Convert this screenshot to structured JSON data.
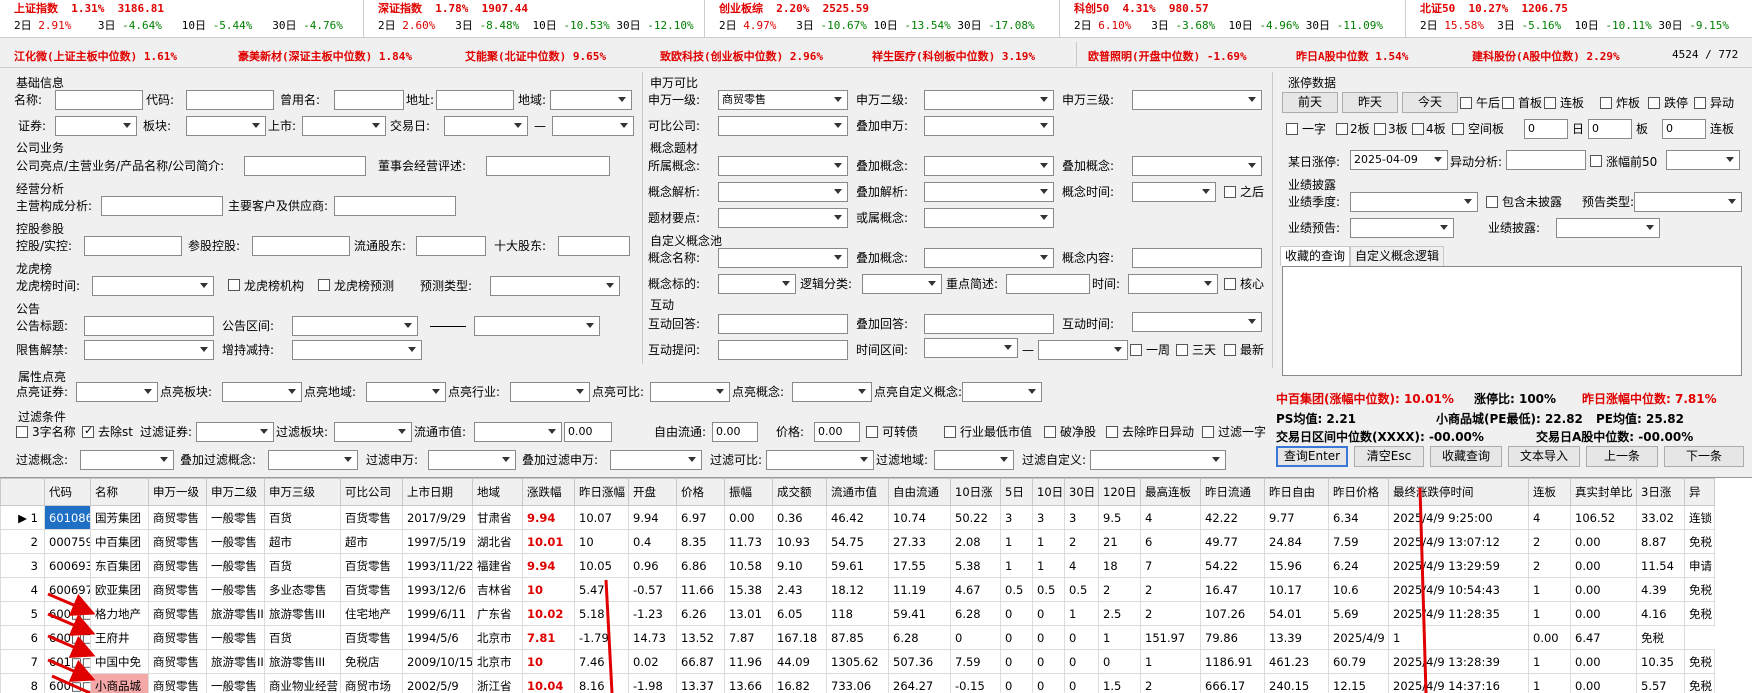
{
  "indices": [
    {
      "name": "上证指数",
      "pct": "1.31%",
      "value": "3186.81",
      "d2": "2.91%",
      "d3": "-4.64%",
      "d10": "-5.44%",
      "d30": "-4.76%"
    },
    {
      "name": "深证指数",
      "pct": "1.78%",
      "value": "1907.44",
      "d2": "2.60%",
      "d3": "-8.48%",
      "d10": "-10.53%",
      "d30": "-12.10%"
    },
    {
      "name": "创业板综",
      "pct": "2.20%",
      "value": "2525.59",
      "d2": "4.97%",
      "d3": "-10.67%",
      "d10": "-13.54%",
      "d30": "-17.08%"
    },
    {
      "name": "科创50",
      "pct": "4.31%",
      "value": "980.57",
      "d2": "6.10%",
      "d3": "-3.68%",
      "d10": "-4.96%",
      "d30": "-11.09%"
    },
    {
      "name": "北证50",
      "pct": "10.27%",
      "value": "1206.75",
      "d2": "15.58%",
      "d3": "-5.16%",
      "d10": "-10.11%",
      "d30": "-9.15%"
    }
  ],
  "index_period_labels": {
    "d2": "2日",
    "d3": "3日",
    "d10": "10日",
    "d30": "30日"
  },
  "medians": [
    "江化微(上证主板中位数) 1.61%",
    "豪美新材(深证主板中位数) 1.84%",
    "艾能聚(北证中位数) 9.65%",
    "致欧科技(创业板中位数) 2.96%",
    "祥生医疗(科创板中位数) 3.19%",
    "欧普照明(开盘中位数) -1.69%",
    "昨日A股中位数 1.54%",
    "建科股份(A股中位数) 2.29%"
  ],
  "up_down_count": "4524 / 772",
  "left": {
    "basic_title": "基础信息",
    "name_l": "名称:",
    "code_l": "代码:",
    "former_l": "曾用名:",
    "addr_l": "地址:",
    "region_l": "地域:",
    "sec_l": "证券:",
    "board_l": "板块:",
    "listing_l": "上市:",
    "trade_l": "交易日:",
    "dash": "—",
    "biz_title": "公司业务",
    "biz_l": "公司亮点/主营业务/产品名称/公司简介:",
    "board_review_l": "董事会经营评述:",
    "ops_title": "经营分析",
    "main_l": "主营构成分析:",
    "cust_l": "主要客户及供应商:",
    "hold_title": "控股参股",
    "hold_l": "控股/实控:",
    "part_l": "参股控股:",
    "float_l": "流通股东:",
    "top10_l": "十大股东:",
    "dragon_title": "龙虎榜",
    "dragon_time_l": "龙虎榜时间:",
    "dragon_org_l": "龙虎榜机构",
    "dragon_pred_l": "龙虎榜预测",
    "pred_type_l": "预测类型:",
    "notice_title": "公告",
    "notice_l": "公告标题:",
    "notice_range_l": "公告区间:",
    "unlock_l": "限售解禁:",
    "hold_change_l": "增持减持:",
    "attr_title": "属性点亮",
    "hl_sec_l": "点亮证券:",
    "hl_board_l": "点亮板块:",
    "hl_region_l": "点亮地域:",
    "hl_ind_l": "点亮行业:",
    "hl_comp_l": "点亮可比:",
    "hl_concept_l": "点亮概念:",
    "hl_custom_l": "点亮自定义概念:",
    "filter_title": "过滤条件",
    "f3_l": "3字名称",
    "fst_l": "去除st",
    "f_sec_l": "过滤证券:",
    "f_board_l": "过滤板块:",
    "f_cap_l": "流通市值:",
    "f_cap_v": "0.00",
    "f_free_l": "自由流通:",
    "f_free_v": "0.00",
    "f_price_l": "价格:",
    "f_price_v": "0.00",
    "f_conv_l": "可转债",
    "f_ind_low_l": "行业最低市值",
    "f_break_l": "破净股",
    "f_yest_l": "去除昨日异动",
    "f_oneword_l": "过滤一字",
    "f_concept_l": "过滤概念:",
    "f_addconcept_l": "叠加过滤概念:",
    "f_sw_l": "过滤申万:",
    "f_addsw_l": "叠加过滤申万:",
    "f_comp_l": "过滤可比:",
    "f_region_l": "过滤地域:",
    "f_custom_l": "过滤自定义:"
  },
  "mid": {
    "sw_title": "申万可比",
    "sw1_l": "申万一级:",
    "sw1_v": "商贸零售",
    "sw2_l": "申万二级:",
    "sw3_l": "申万三级:",
    "comp_l": "可比公司:",
    "addsw_l": "叠加申万:",
    "concept_title": "概念题材",
    "own_l": "所属概念:",
    "add1_l": "叠加概念:",
    "add2_l": "叠加概念:",
    "cparse_l": "概念解析:",
    "addparse_l": "叠加解析:",
    "ctime_l": "概念时间:",
    "after_l": "之后",
    "theme_l": "题材要点:",
    "or_l": "或属概念:",
    "custom_title": "自定义概念池",
    "cname_l": "概念名称:",
    "cadd_l": "叠加概念:",
    "ccontent_l": "概念内容:",
    "ctarget_l": "概念标的:",
    "logic_l": "逻辑分类:",
    "brief_l": "重点简述:",
    "time_l": "时间:",
    "core_l": "核心",
    "inter_title": "互动",
    "ans_l": "互动回答:",
    "addans_l": "叠加回答:",
    "itime_l": "互动时间:",
    "ask_l": "互动提问:",
    "range_l": "时间区间:",
    "week_l": "一周",
    "three_l": "三天",
    "latest_l": "最新"
  },
  "right": {
    "limit_title": "涨停数据",
    "btn_pre": "前天",
    "btn_yest": "昨天",
    "btn_today": "今天",
    "am_l": "午后",
    "first_l": "首板",
    "cont_l": "连板",
    "blast_l": "炸板",
    "drop_l": "跌停",
    "abn_l": "异动",
    "oneword_l": "一字",
    "b2_l": "2板",
    "b3_l": "3板",
    "b4_l": "4板",
    "empty_l": "空间板",
    "v0a": "0",
    "day_l": "日",
    "v0b": "0",
    "board_l": "板",
    "v0c": "0",
    "contb_l": "连板",
    "someday_l": "某日涨停:",
    "someday_v": "2025-04-09",
    "abn_anal_l": "异动分析:",
    "top50_l": "涨幅前50",
    "perf_title": "业绩披露",
    "season_l": "业绩季度:",
    "undisc_l": "包含未披露",
    "fore_type_l": "预告类型:",
    "fore_l": "业绩预告:",
    "disc_l": "业绩披露:",
    "tab1": "收藏的查询",
    "tab2": "自定义概念逻辑",
    "s1": "中百集团(涨幅中位数): 10.01%",
    "s2": "涨停比: 100%",
    "s3": "昨日涨幅中位数: 7.81%",
    "ps": "PS均值: 2.21",
    "small": "小商品城(PE最低): 22.82",
    "pe": "PE均值: 25.82",
    "range_med": "交易日区间中位数(XXXX):    -00.00%",
    "a_med": "交易日A股中位数:  -00.00%",
    "b_query": "查询Enter",
    "b_clear": "清空Esc",
    "b_fav": "收藏查询",
    "b_import": "文本导入",
    "b_prev": "上一条",
    "b_next": "下一条"
  },
  "table": {
    "headers": [
      "",
      "代码",
      "名称",
      "申万一级",
      "申万二级",
      "申万三级",
      "可比公司",
      "上市日期",
      "地域",
      "涨跌幅",
      "昨日涨幅",
      "开盘",
      "价格",
      "振幅",
      "成交额",
      "流通市值",
      "自由流通",
      "10日涨",
      "5日",
      "10日",
      "30日",
      "120日",
      "最高连板",
      "昨日流通",
      "昨日自由",
      "昨日价格",
      "最终涨跌停时间",
      "连板",
      "真实封单比",
      "3日涨",
      "异"
    ],
    "rows": [
      [
        "▶ 1",
        "601086",
        "国芳集团",
        "商贸零售",
        "一般零售",
        "百货",
        "百货零售",
        "2017/9/29",
        "甘肃省",
        "9.94",
        "10.07",
        "9.94",
        "6.97",
        "0.00",
        "0.36",
        "46.42",
        "10.74",
        "50.22",
        "3",
        "3",
        "3",
        "9.5",
        "4",
        "42.22",
        "9.77",
        "6.34",
        "2025/4/9 9:25:00",
        "4",
        "106.52",
        "33.02",
        "连锁"
      ],
      [
        "2",
        "000759",
        "中百集团",
        "商贸零售",
        "一般零售",
        "超市",
        "超市",
        "1997/5/19",
        "湖北省",
        "10.01",
        "10",
        "0.4",
        "8.35",
        "11.73",
        "10.93",
        "54.75",
        "27.33",
        "2.08",
        "1",
        "1",
        "2",
        "21",
        "6",
        "49.77",
        "24.84",
        "7.59",
        "2025/4/9 13:07:12",
        "2",
        "0.00",
        "8.87",
        "免税"
      ],
      [
        "3",
        "600693",
        "东百集团",
        "商贸零售",
        "一般零售",
        "百货",
        "百货零售",
        "1993/11/22",
        "福建省",
        "9.94",
        "10.05",
        "0.96",
        "6.86",
        "10.58",
        "9.10",
        "59.61",
        "17.55",
        "5.38",
        "1",
        "1",
        "4",
        "18",
        "7",
        "54.22",
        "15.96",
        "6.24",
        "2025/4/9 13:29:59",
        "2",
        "0.00",
        "11.54",
        "申请"
      ],
      [
        "4",
        "600697",
        "欧亚集团",
        "商贸零售",
        "一般零售",
        "多业态零售",
        "百货零售",
        "1993/12/6",
        "吉林省",
        "10",
        "5.47",
        "-0.57",
        "11.66",
        "15.38",
        "2.43",
        "18.12",
        "11.19",
        "4.67",
        "0.5",
        "0.5",
        "0.5",
        "2",
        "2",
        "16.47",
        "10.17",
        "10.6",
        "2025/4/9 10:54:43",
        "1",
        "0.00",
        "4.39",
        "免税"
      ],
      [
        "5",
        "600□□□",
        "格力地产",
        "商贸零售",
        "旅游零售II",
        "旅游零售III",
        "住宅地产",
        "1999/6/11",
        "广东省",
        "10.02",
        "5.18",
        "-1.23",
        "6.26",
        "13.01",
        "6.05",
        "118",
        "59.41",
        "6.28",
        "0",
        "0",
        "1",
        "2.5",
        "2",
        "107.26",
        "54.01",
        "5.69",
        "2025/4/9 11:28:35",
        "1",
        "0.00",
        "4.16",
        "免税"
      ],
      [
        "6",
        "600□□□",
        "王府井",
        "商贸零售",
        "一般零售",
        "百货",
        "百货零售",
        "1994/5/6",
        "北京市",
        "7.81",
        "-1.79",
        "14.73",
        "13.52",
        "7.87",
        "167.18",
        "87.85",
        "6.28",
        "0",
        "0",
        "0",
        "0",
        "1",
        "151.97",
        "79.86",
        "13.39",
        "2025/4/9 13:01:54",
        "1",
        "0.00",
        "6.47",
        "免税"
      ],
      [
        "7",
        "601□□□",
        "中国中免",
        "商贸零售",
        "旅游零售II",
        "旅游零售III",
        "免税店",
        "2009/10/15",
        "北京市",
        "10",
        "7.46",
        "0.02",
        "66.87",
        "11.96",
        "44.09",
        "1305.62",
        "507.36",
        "7.59",
        "0",
        "0",
        "0",
        "0",
        "1",
        "1186.91",
        "461.23",
        "60.79",
        "2025/4/9 13:28:39",
        "1",
        "0.00",
        "10.35",
        "免税"
      ],
      [
        "8",
        "600□□□",
        "小商品城",
        "商贸零售",
        "一般零售",
        "商业物业经营",
        "商贸市场",
        "2002/5/9",
        "浙江省",
        "10.04",
        "8.16",
        "-1.98",
        "13.37",
        "13.66",
        "16.82",
        "733.06",
        "264.27",
        "-0.15",
        "0",
        "0",
        "0",
        "1.5",
        "2",
        "666.17",
        "240.15",
        "12.15",
        "2025/4/9 14:37:16",
        "1",
        "0.00",
        "5.57",
        "免税"
      ]
    ]
  }
}
